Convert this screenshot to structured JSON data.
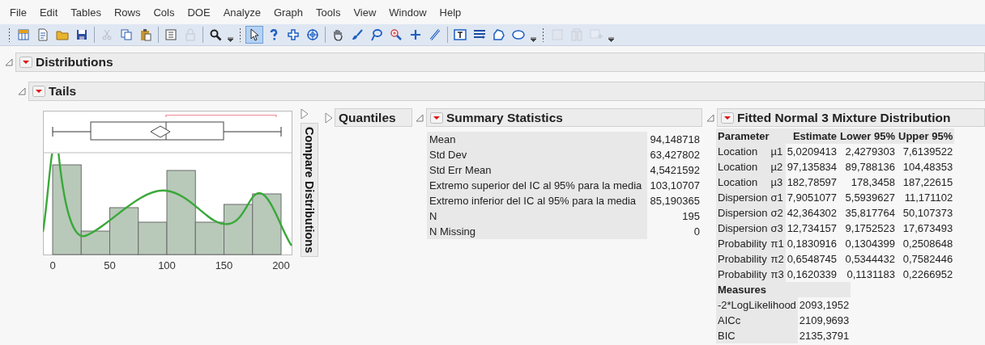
{
  "menu": [
    "File",
    "Edit",
    "Tables",
    "Rows",
    "Cols",
    "DOE",
    "Analyze",
    "Graph",
    "Tools",
    "View",
    "Window",
    "Help"
  ],
  "toolbar": [
    {
      "kind": "grip"
    },
    {
      "kind": "new-table",
      "selected": false,
      "disabled": false
    },
    {
      "kind": "new-script",
      "selected": false,
      "disabled": false
    },
    {
      "kind": "open",
      "selected": false,
      "disabled": false
    },
    {
      "kind": "save",
      "selected": false,
      "disabled": false
    },
    {
      "kind": "sep"
    },
    {
      "kind": "cut",
      "selected": false,
      "disabled": true
    },
    {
      "kind": "copy",
      "selected": false,
      "disabled": false
    },
    {
      "kind": "paste",
      "selected": false,
      "disabled": false
    },
    {
      "kind": "sep"
    },
    {
      "kind": "data",
      "selected": false,
      "disabled": false
    },
    {
      "kind": "lock",
      "selected": false,
      "disabled": true
    },
    {
      "kind": "sep"
    },
    {
      "kind": "search",
      "selected": false,
      "disabled": false
    },
    {
      "kind": "more"
    },
    {
      "kind": "grip"
    },
    {
      "kind": "pointer",
      "selected": true,
      "disabled": false
    },
    {
      "kind": "help",
      "selected": false,
      "disabled": false
    },
    {
      "kind": "crosshair",
      "selected": false,
      "disabled": false
    },
    {
      "kind": "target",
      "selected": false,
      "disabled": false
    },
    {
      "kind": "sep"
    },
    {
      "kind": "hand",
      "selected": false,
      "disabled": false
    },
    {
      "kind": "brush",
      "selected": false,
      "disabled": false
    },
    {
      "kind": "lasso",
      "selected": false,
      "disabled": false
    },
    {
      "kind": "zoom",
      "selected": false,
      "disabled": false
    },
    {
      "kind": "plus",
      "selected": false,
      "disabled": false
    },
    {
      "kind": "line",
      "selected": false,
      "disabled": false
    },
    {
      "kind": "sep"
    },
    {
      "kind": "text-box",
      "selected": false,
      "disabled": false
    },
    {
      "kind": "lines",
      "selected": false,
      "disabled": false
    },
    {
      "kind": "polygon",
      "selected": false,
      "disabled": false
    },
    {
      "kind": "ellipse",
      "selected": false,
      "disabled": false
    },
    {
      "kind": "more"
    },
    {
      "kind": "grip"
    },
    {
      "kind": "report",
      "selected": false,
      "disabled": true
    },
    {
      "kind": "columns",
      "selected": false,
      "disabled": true
    },
    {
      "kind": "add-chart",
      "selected": false,
      "disabled": true
    },
    {
      "kind": "more"
    }
  ],
  "distributions": {
    "title": "Distributions",
    "expanded": true
  },
  "tails": {
    "title": "Tails",
    "expanded": true,
    "plot": {
      "x_tick_labels": [
        "0",
        "50",
        "100",
        "150",
        "200"
      ]
    },
    "compare": {
      "label": "Compare Distributions",
      "expanded": false
    },
    "quantiles": {
      "title": "Quantiles",
      "expanded": false
    },
    "summary": {
      "title": "Summary Statistics",
      "expanded": true,
      "rows": [
        {
          "label": "Mean",
          "value": "94,148718"
        },
        {
          "label": "Std Dev",
          "value": "63,427802"
        },
        {
          "label": "Std Err Mean",
          "value": "4,5421592"
        },
        {
          "label": "Extremo superior del IC al 95% para la media",
          "value": "103,10707"
        },
        {
          "label": "Extremo inferior del IC al 95% para la media",
          "value": "85,190365"
        },
        {
          "label": "N",
          "value": "195"
        },
        {
          "label": "N Missing",
          "value": "0"
        }
      ]
    },
    "fitted": {
      "title": "Fitted Normal 3 Mixture Distribution",
      "expanded": true,
      "columns": [
        "Parameter",
        "Estimate",
        "Lower 95%",
        "Upper 95%"
      ],
      "rows": [
        {
          "parameter": "Location",
          "symbol": "µ1",
          "estimate": "5,0209413",
          "lower": "2,4279303",
          "upper": "7,6139522"
        },
        {
          "parameter": "Location",
          "symbol": "µ2",
          "estimate": "97,135834",
          "lower": "89,788136",
          "upper": "104,48353"
        },
        {
          "parameter": "Location",
          "symbol": "µ3",
          "estimate": "182,78597",
          "lower": "178,3458",
          "upper": "187,22615"
        },
        {
          "parameter": "Dispersion",
          "symbol": "σ1",
          "estimate": "7,9051077",
          "lower": "5,5939627",
          "upper": "11,171102"
        },
        {
          "parameter": "Dispersion",
          "symbol": "σ2",
          "estimate": "42,364302",
          "lower": "35,817764",
          "upper": "50,107373"
        },
        {
          "parameter": "Dispersion",
          "symbol": "σ3",
          "estimate": "12,734157",
          "lower": "9,1752523",
          "upper": "17,673493"
        },
        {
          "parameter": "Probability",
          "symbol": "π1",
          "estimate": "0,1830916",
          "lower": "0,1304399",
          "upper": "0,2508648"
        },
        {
          "parameter": "Probability",
          "symbol": "π2",
          "estimate": "0,6548745",
          "lower": "0,5344432",
          "upper": "0,7582446"
        },
        {
          "parameter": "Probability",
          "symbol": "π3",
          "estimate": "0,1620339",
          "lower": "0,1131183",
          "upper": "0,2266952"
        }
      ],
      "measures": {
        "title": "Measures",
        "rows": [
          {
            "label": "-2*LogLikelihood",
            "value": "2093,1952"
          },
          {
            "label": "AICc",
            "value": "2109,9693"
          },
          {
            "label": "BIC",
            "value": "2135,3791"
          }
        ]
      }
    }
  }
}
